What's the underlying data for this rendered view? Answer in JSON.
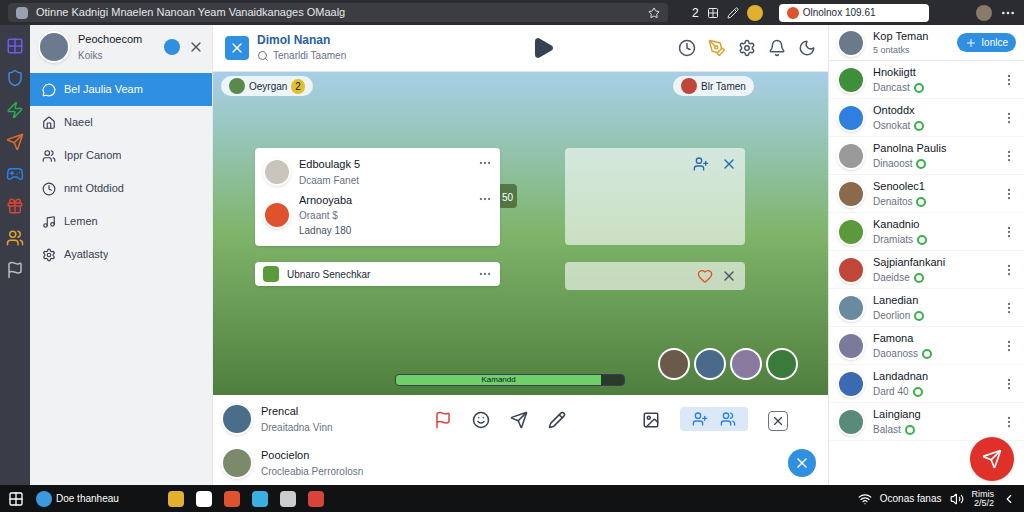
{
  "browser": {
    "tab_title": "Otinne Kadnigi Mnaelen Nanoan Yeam Vanaidkanages OMaalg",
    "badge": "2",
    "tab2": "Olnolnox 109.61"
  },
  "sidebar": {
    "user": {
      "name": "Peochoecom",
      "sub": "Koiks",
      "color": "#6b7a8f"
    },
    "items": [
      {
        "label": "Bel Jaulia Veam",
        "selected": true
      },
      {
        "label": "Naeel",
        "selected": false
      },
      {
        "label": "Ippr Canom",
        "selected": false
      },
      {
        "label": "nmt Otddiod",
        "selected": false
      },
      {
        "label": "Lemen",
        "selected": false
      },
      {
        "label": "Ayatlasty",
        "selected": false
      }
    ]
  },
  "header": {
    "title": "Dimol Nanan",
    "search": "Tenarldi Taamen"
  },
  "game": {
    "top_left": "Oeyrgan",
    "top_left_count": "2",
    "top_right": "Blr Tamen",
    "score": "50",
    "health": {
      "label": "Kamandd",
      "level": 0.9
    },
    "chat_entries": [
      {
        "name": "Edboulagk 5",
        "sub": "Dcaam Fanet",
        "color": "#c9c4bc"
      },
      {
        "name": "Arnooyaba",
        "sub": "Oraant $",
        "extra": "Ladnay 180",
        "color": "#e0522e"
      }
    ],
    "mini_card": "Ubnaro Senechkar"
  },
  "bottom": {
    "rows": [
      {
        "name": "Prencal",
        "sub": "Dreaitadna Vinn",
        "color": "#4a6e8a"
      },
      {
        "name": "Poocielon",
        "sub": "Crocleabia Perrorolosn",
        "color": "#7a8a6a"
      }
    ]
  },
  "friends": {
    "title": "Kop Teman",
    "subtitle": "5 ontatks",
    "button": "Ionlce",
    "items": [
      {
        "name": "Hnokiigtt",
        "sub": "Dancast",
        "color": "#3f8f3a"
      },
      {
        "name": "Ontoddx",
        "sub": "Osnokat",
        "color": "#2f7fe0"
      },
      {
        "name": "Panolna Paulis",
        "sub": "Dinaoost",
        "color": "#9a9a9a"
      },
      {
        "name": "Senoolec1",
        "sub": "Denaitos",
        "color": "#8a6a4a"
      },
      {
        "name": "Kanadnio",
        "sub": "Dramiats",
        "color": "#5a9a3a"
      },
      {
        "name": "Sajpianfankani",
        "sub": "Daeidse",
        "color": "#c0463a"
      },
      {
        "name": "Lanedian",
        "sub": "Deorlion",
        "color": "#6a8aa0"
      },
      {
        "name": "Famona",
        "sub": "Daoanoss",
        "color": "#7a7a9a"
      },
      {
        "name": "Landadnan",
        "sub": "Dard 40",
        "color": "#3a6ab0"
      },
      {
        "name": "Laingiang",
        "sub": "Balast",
        "color": "#5a8a7a"
      }
    ]
  },
  "taskbar": {
    "app": "Doe thanheau",
    "tray": "Oconas fanas",
    "clock": "Rimis",
    "date": "2/5/2"
  }
}
